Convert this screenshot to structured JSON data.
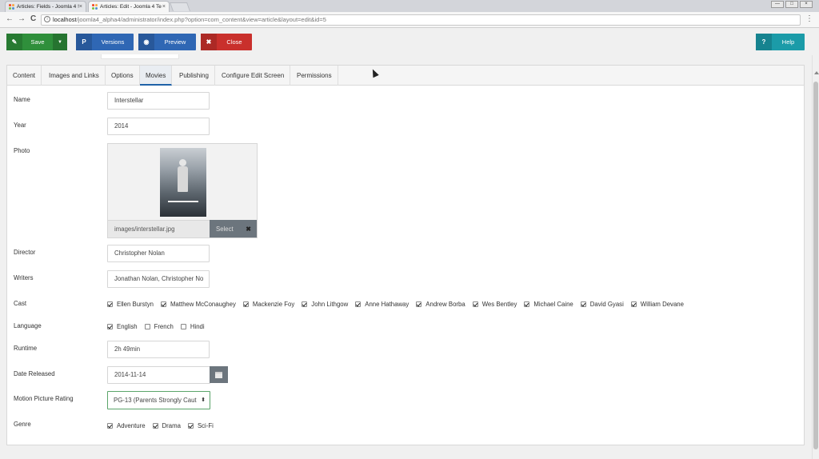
{
  "browser": {
    "tabs": [
      {
        "title": "Articles: Fields - Joomla 4 !",
        "close": "×"
      },
      {
        "title": "Articles: Edit - Joomla 4 Te",
        "close": "×"
      }
    ],
    "window_controls": [
      "—",
      "□",
      "×"
    ],
    "url_host": "localhost",
    "url_path": "/joomla4_alpha4/administrator/index.php?option=com_content&view=article&layout=edit&id=5",
    "nav": {
      "back": "←",
      "forward": "→",
      "reload": "C"
    },
    "menu": "⋮"
  },
  "toolbar": {
    "save": {
      "icon": "✎",
      "label": "Save",
      "caret": "▼"
    },
    "versions": {
      "icon": "P",
      "label": "Versions"
    },
    "preview": {
      "icon": "◉",
      "label": "Preview"
    },
    "close": {
      "icon": "✖",
      "label": "Close"
    },
    "help": {
      "icon": "?",
      "label": "Help"
    }
  },
  "tabs": [
    "Content",
    "Images and Links",
    "Options",
    "Movies",
    "Publishing",
    "Configure Edit Screen",
    "Permissions"
  ],
  "active_tab": "Movies",
  "form": {
    "name": {
      "label": "Name",
      "value": "Interstellar"
    },
    "year": {
      "label": "Year",
      "value": "2014"
    },
    "photo": {
      "label": "Photo",
      "path": "images/interstellar.jpg",
      "select": "Select",
      "clear": "✖"
    },
    "director": {
      "label": "Director",
      "value": "Christopher Nolan"
    },
    "writers": {
      "label": "Writers",
      "value": "Jonathan Nolan, Christopher No"
    },
    "cast": {
      "label": "Cast",
      "options": [
        {
          "name": "Ellen Burstyn",
          "checked": true
        },
        {
          "name": "Matthew McConaughey",
          "checked": true
        },
        {
          "name": "Mackenzie Foy",
          "checked": true
        },
        {
          "name": "John Lithgow",
          "checked": true
        },
        {
          "name": "Anne Hathaway",
          "checked": true
        },
        {
          "name": "Andrew Borba",
          "checked": true
        },
        {
          "name": "Wes Bentley",
          "checked": true
        },
        {
          "name": "Michael Caine",
          "checked": true
        },
        {
          "name": "David Gyasi",
          "checked": true
        },
        {
          "name": "William Devane",
          "checked": true
        }
      ]
    },
    "language": {
      "label": "Language",
      "options": [
        {
          "name": "English",
          "checked": true
        },
        {
          "name": "French",
          "checked": false
        },
        {
          "name": "Hindi",
          "checked": false
        }
      ]
    },
    "runtime": {
      "label": "Runtime",
      "value": "2h 49min"
    },
    "date_released": {
      "label": "Date Released",
      "value": "2014-11-14"
    },
    "rating": {
      "label": "Motion Picture Rating",
      "value": "PG-13 (Parents Strongly Caut",
      "arrow": "⬍"
    },
    "genre": {
      "label": "Genre",
      "options": [
        {
          "name": "Adventure",
          "checked": true
        },
        {
          "name": "Drama",
          "checked": true
        },
        {
          "name": "Sci-Fi",
          "checked": true
        }
      ]
    }
  },
  "icons": {
    "save": "edit-icon",
    "versions": "versions-icon",
    "preview": "eye-icon",
    "close": "close-icon",
    "help": "question-icon",
    "calendar": "calendar-icon"
  },
  "colors": {
    "save": "#2f8f3b",
    "primary": "#2f67b4",
    "danger": "#c9302c",
    "help": "#1b9ba8",
    "select_border": "#5aa469"
  }
}
